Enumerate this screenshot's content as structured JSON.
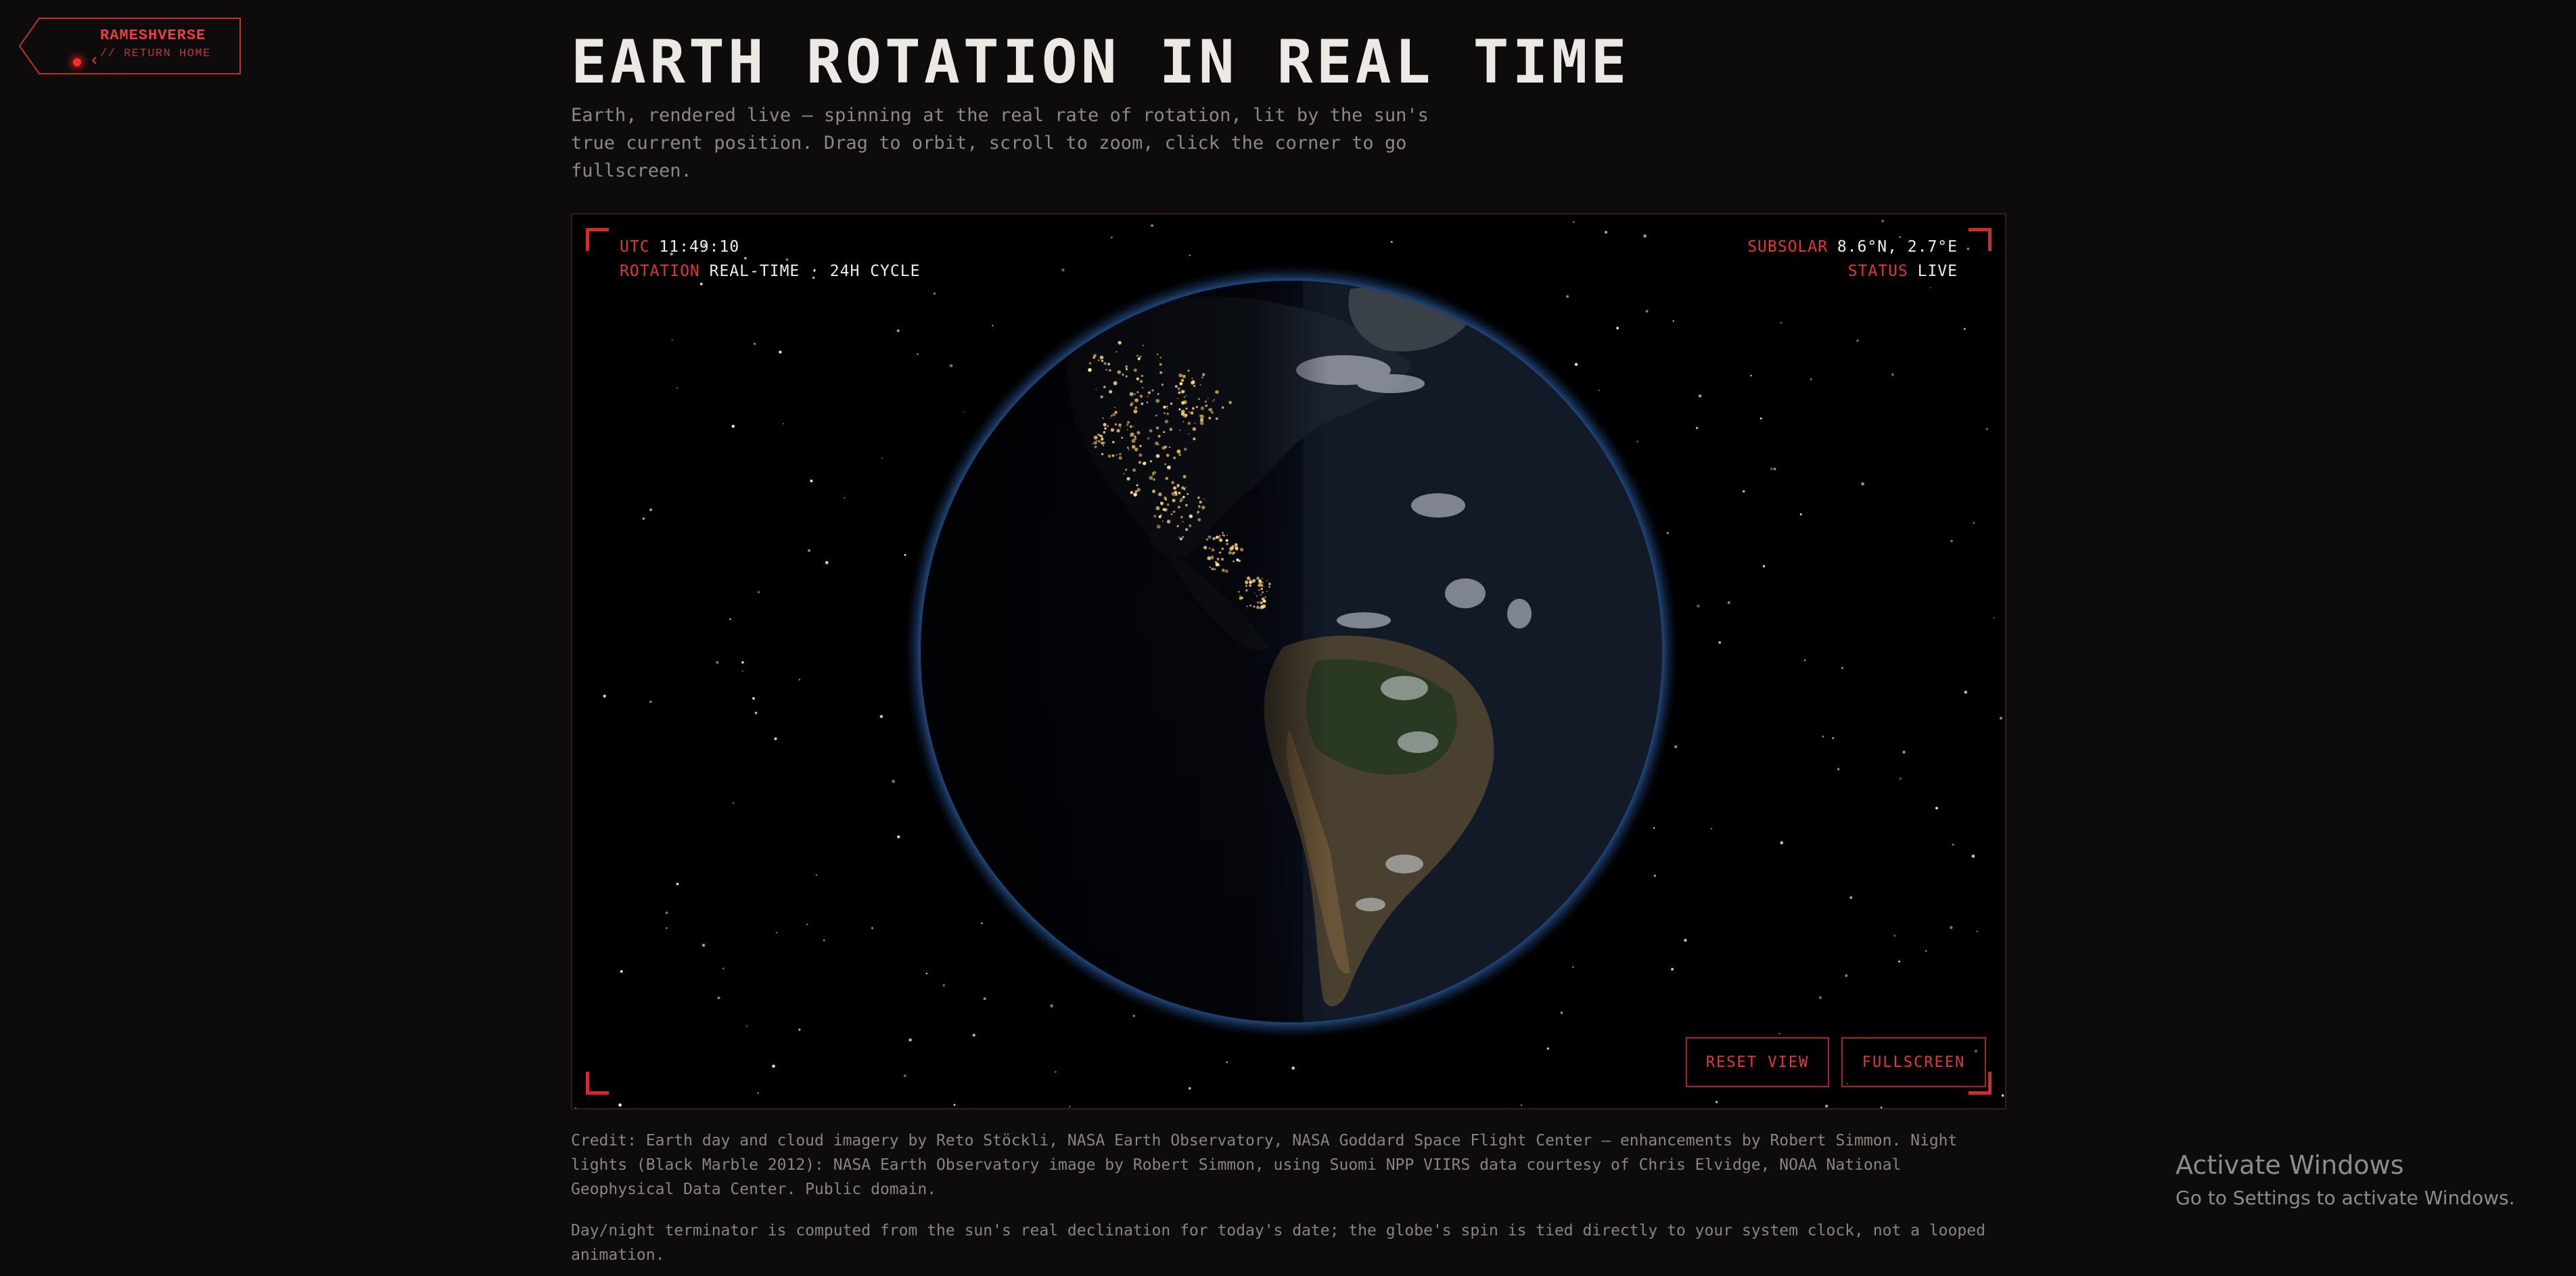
{
  "home": {
    "brand": "RAMESHVERSE",
    "subtitle": "// RETURN HOME"
  },
  "page": {
    "title": "EARTH ROTATION IN REAL TIME",
    "intro": "Earth, rendered live — spinning at the real rate of rotation, lit by the sun's true current position. Drag to orbit, scroll to zoom, click the corner to go fullscreen."
  },
  "hud": {
    "utc_label": "UTC",
    "utc_value": "11:49:10",
    "rotation_label": "ROTATION",
    "rotation_value": "REAL-TIME · 24H CYCLE",
    "subsolar_label": "SUBSOLAR",
    "subsolar_value": "8.6°N, 2.7°E",
    "status_label": "STATUS",
    "status_value": "LIVE"
  },
  "controls": {
    "reset_label": "RESET VIEW",
    "fullscreen_label": "FULLSCREEN"
  },
  "credits": {
    "imagery": "Credit: Earth day and cloud imagery by Reto Stöckli, NASA Earth Observatory, NASA Goddard Space Flight Center — enhancements by Robert Simmon. Night lights (Black Marble 2012): NASA Earth Observatory image by Robert Simmon, using Suomi NPP VIIRS data courtesy of Chris Elvidge, NOAA National Geophysical Data Center. Public domain.",
    "terminator": "Day/night terminator is computed from the sun's real declination for today's date; the globe's spin is tied directly to your system clock, not a looped animation."
  },
  "watermark": {
    "title": "Activate Windows",
    "subtitle": "Go to Settings to activate Windows."
  },
  "colors": {
    "accent": "#e03636",
    "background": "#0d0b0b",
    "panel_border": "#3a1a1a",
    "text": "#ece8e4",
    "muted": "#8e8884"
  },
  "icons": {
    "home_back": "chevron-left-icon",
    "status_dot": "red-dot-icon"
  }
}
